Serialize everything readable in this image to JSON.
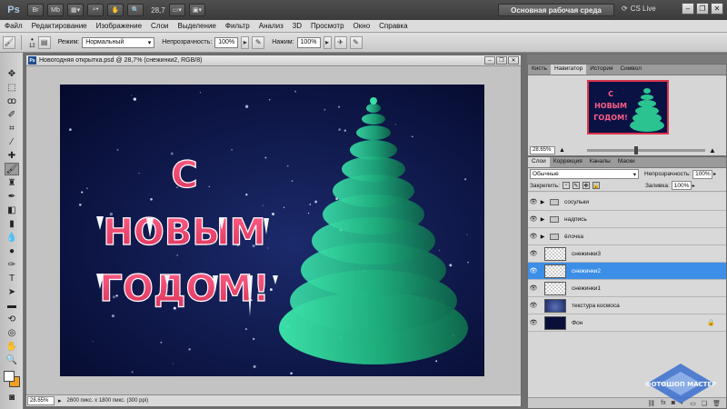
{
  "appbar": {
    "logo": "Ps",
    "buttons": [
      "Br",
      "Mb"
    ],
    "zoom": "28,7",
    "workspace": "Основная рабочая среда",
    "cs_live": "CS Live"
  },
  "menu": [
    "Файл",
    "Редактирование",
    "Изображение",
    "Слои",
    "Выделение",
    "Фильтр",
    "Анализ",
    "3D",
    "Просмотр",
    "Окно",
    "Справка"
  ],
  "options": {
    "brush_size": "12",
    "mode_label": "Режим:",
    "mode_value": "Нормальный",
    "opacity_label": "Непрозрачность:",
    "opacity_value": "100%",
    "flow_label": "Нажим:",
    "flow_value": "100%"
  },
  "document": {
    "title": "Новогодняя открытка.psd @ 28,7% (снежинки2, RGB/8)",
    "status_zoom": "28.65%",
    "status_info": "2600 пикс. x 1800 пикс. (300 ppi)"
  },
  "artwork": {
    "line1": "С",
    "line2": "НОВЫМ",
    "line3": "ГОДОМ!"
  },
  "navigator": {
    "tabs": [
      "Кисть",
      "Навигатор",
      "История",
      "Символ"
    ],
    "zoom": "28.65%"
  },
  "layers": {
    "tabs": [
      "Слои",
      "Коррекция",
      "Каналы",
      "Маски"
    ],
    "blend_mode": "Обычные",
    "opacity_label": "Непрозрачность:",
    "opacity_value": "100%",
    "lock_label": "Закрепить:",
    "fill_label": "Заливка:",
    "fill_value": "100%",
    "items": [
      {
        "name": "сосульки"
      },
      {
        "name": "надпись"
      },
      {
        "name": "ёлочка"
      },
      {
        "name": "снежинки3"
      },
      {
        "name": "снежинки2"
      },
      {
        "name": "снежинки1"
      },
      {
        "name": "текстура космоса"
      },
      {
        "name": "Фон"
      }
    ]
  },
  "watermark": {
    "text": "ФОТОШОП МАСТЕР"
  },
  "colors": {
    "foreground": "#ffffff",
    "background": "#f0a020",
    "selected_layer": "#3d8ee6",
    "title_pink": "#e8436a",
    "tree_green": "#2fd89a"
  }
}
